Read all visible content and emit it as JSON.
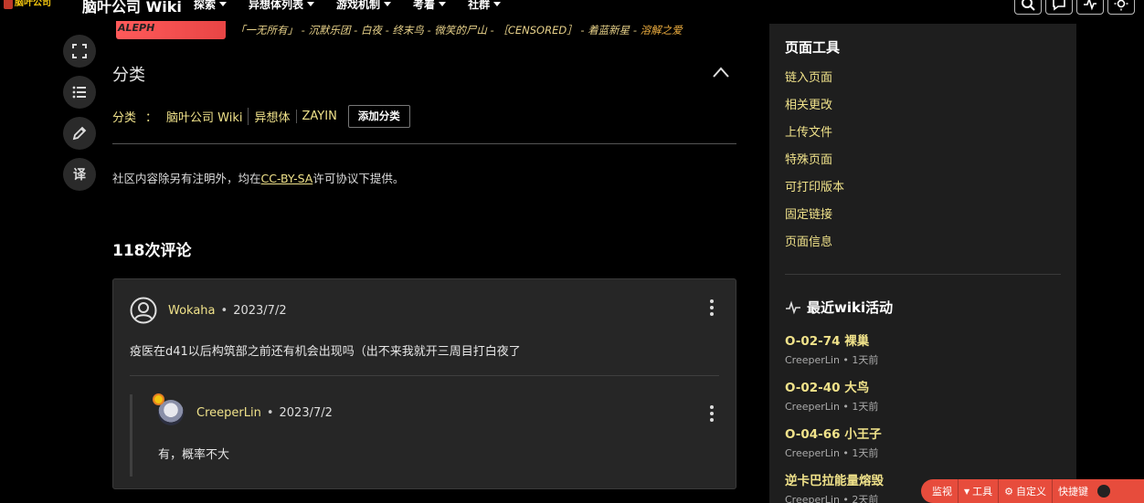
{
  "site": {
    "logo_text": "脑叶公司",
    "title": "脑叶公司 Wiki",
    "nav": [
      {
        "label": "探索"
      },
      {
        "label": "异想体列表"
      },
      {
        "label": "游戏机制"
      },
      {
        "label": "考着"
      },
      {
        "label": "社群"
      }
    ]
  },
  "left_tools": {
    "translate_label": "译"
  },
  "risk_nav": {
    "badge": "ALEPH",
    "links": [
      "「一无所有」",
      "沉默乐团",
      "白夜",
      "终末鸟",
      "微笑的尸山",
      "［CENSORED］",
      "着蓝新星"
    ],
    "last_link": "溶解之爱",
    "separator": " - "
  },
  "categories": {
    "section_title": "分类",
    "label": "分类",
    "colon": "：",
    "links": [
      "脑叶公司 Wiki",
      "异想体",
      "ZAYIN"
    ],
    "add_button": "添加分类"
  },
  "license": {
    "before": "社区内容除另有注明外，均在",
    "link": "CC-BY-SA",
    "after": "许可协议下提供。"
  },
  "comments": {
    "title": "118次评论",
    "dot": "•",
    "main": {
      "author": "Wokaha",
      "date": "2023/7/2",
      "text": "疫医在d41以后构筑部之前还有机会出现吗（出不来我就开三周目打白夜了"
    },
    "reply": {
      "author": "CreeperLin",
      "date": "2023/7/2",
      "text": "有，概率不大"
    }
  },
  "sidebar": {
    "tools_title": "页面工具",
    "tools": [
      "链入页面",
      "相关更改",
      "上传文件",
      "特殊页面",
      "可打印版本",
      "固定链接",
      "页面信息"
    ],
    "activity_title": "最近wiki活动",
    "activity": [
      {
        "title": "O-02-74 裸巢",
        "meta": "CreeperLin • 1天前"
      },
      {
        "title": "O-02-40 大鸟",
        "meta": "CreeperLin • 1天前"
      },
      {
        "title": "O-04-66 小王子",
        "meta": "CreeperLin • 1天前"
      },
      {
        "title": "逆卡巴拉能量熔毁",
        "meta": "CreeperLin • 2天前"
      }
    ]
  },
  "bottom_toolbar": {
    "items": [
      "监视",
      "工具",
      "自定义",
      "快捷键"
    ]
  },
  "colors": {
    "accent_yellow": "#f0e28a",
    "aleph_red": "#e84545",
    "toolbar_red": "#e74c3c",
    "panel_bg": "#1e1e1e"
  }
}
